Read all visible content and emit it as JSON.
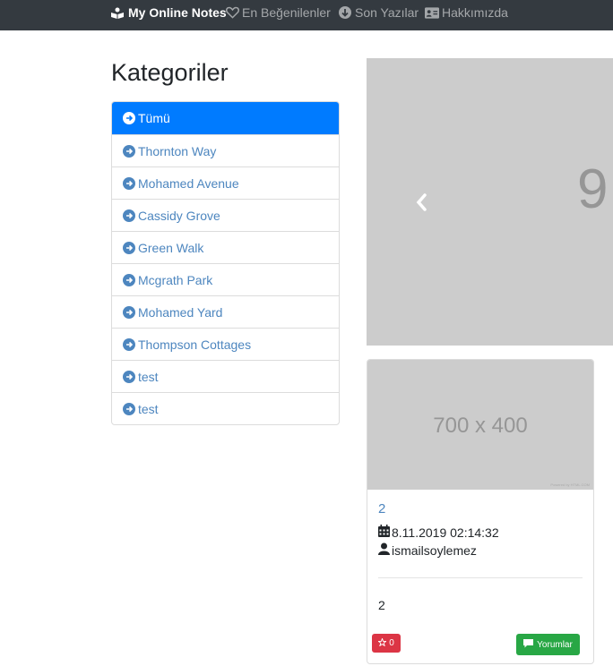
{
  "navbar": {
    "brand": "My Online Notes",
    "links": {
      "liked": "En Beğenilenler",
      "latest": "Son Yazılar",
      "about": "Hakkımızda"
    }
  },
  "sidebar": {
    "title": "Kategoriler",
    "items": [
      {
        "label": "Tümü"
      },
      {
        "label": "Thornton Way"
      },
      {
        "label": "Mohamed Avenue"
      },
      {
        "label": "Cassidy Grove"
      },
      {
        "label": "Green Walk"
      },
      {
        "label": "Mcgrath Park"
      },
      {
        "label": "Mohamed Yard"
      },
      {
        "label": "Thompson Cottages"
      },
      {
        "label": "test"
      },
      {
        "label": "test"
      }
    ]
  },
  "carousel": {
    "slide_text": "9"
  },
  "card": {
    "image_text": "700 x 400",
    "image_credit": "Powered by HTML.COM",
    "title": "2",
    "date": "8.11.2019 02:14:32",
    "author": "ismailsoylemez",
    "body": "2",
    "likes": "0",
    "comments_label": "Yorumlar"
  },
  "colors": {
    "navbar": "#343a40",
    "active": "#007bff",
    "link": "#4d86bf",
    "like": "#dc3545",
    "comment": "#28a745",
    "placeholder": "#cccccc"
  }
}
